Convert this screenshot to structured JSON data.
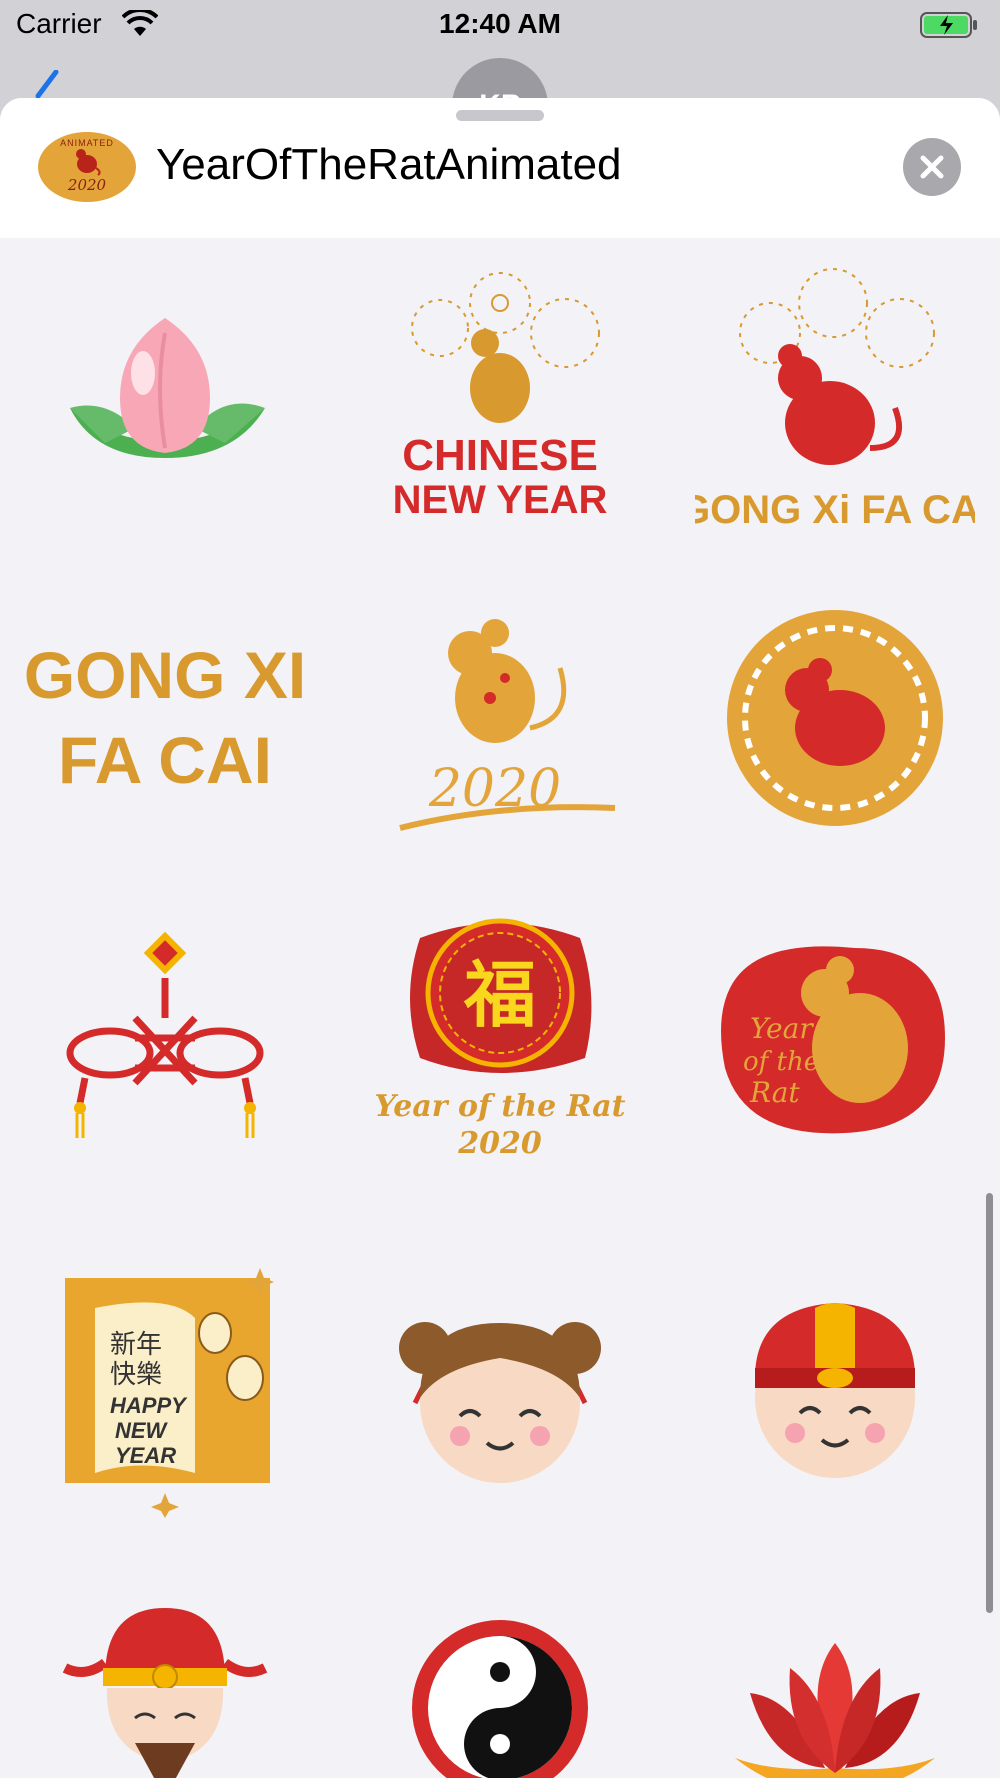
{
  "status_bar": {
    "carrier": "Carrier",
    "time": "12:40 AM"
  },
  "background_chat": {
    "avatar_initials": "KP"
  },
  "sheet": {
    "app_title": "YearOfTheRatAnimated",
    "app_icon_top": "ANIMATED",
    "app_icon_year": "2020"
  },
  "stickers": {
    "chinese_new_year_line1": "CHINESE",
    "chinese_new_year_line2": "NEW YEAR",
    "gong_xi_fa_cai": "GONG Xi FA CAi",
    "gong_xi_line1": "GONG XI",
    "gong_xi_line2": "FA CAI",
    "rat_2020_year": "2020",
    "fu_character": "福",
    "fu_caption_line1": "Year of the Rat",
    "fu_caption_line2": "2020",
    "red_rat_line1": "Year",
    "red_rat_line2": "of the",
    "red_rat_line3": "Rat",
    "scroll_chars_1": "新年",
    "scroll_chars_2": "快樂",
    "scroll_line1": "HAPPY",
    "scroll_line2": "NEW",
    "scroll_line3": "YEAR"
  },
  "colors": {
    "red": "#d42a2a",
    "gold": "#d89a2e",
    "sheet_bg": "#f2f2f7"
  }
}
